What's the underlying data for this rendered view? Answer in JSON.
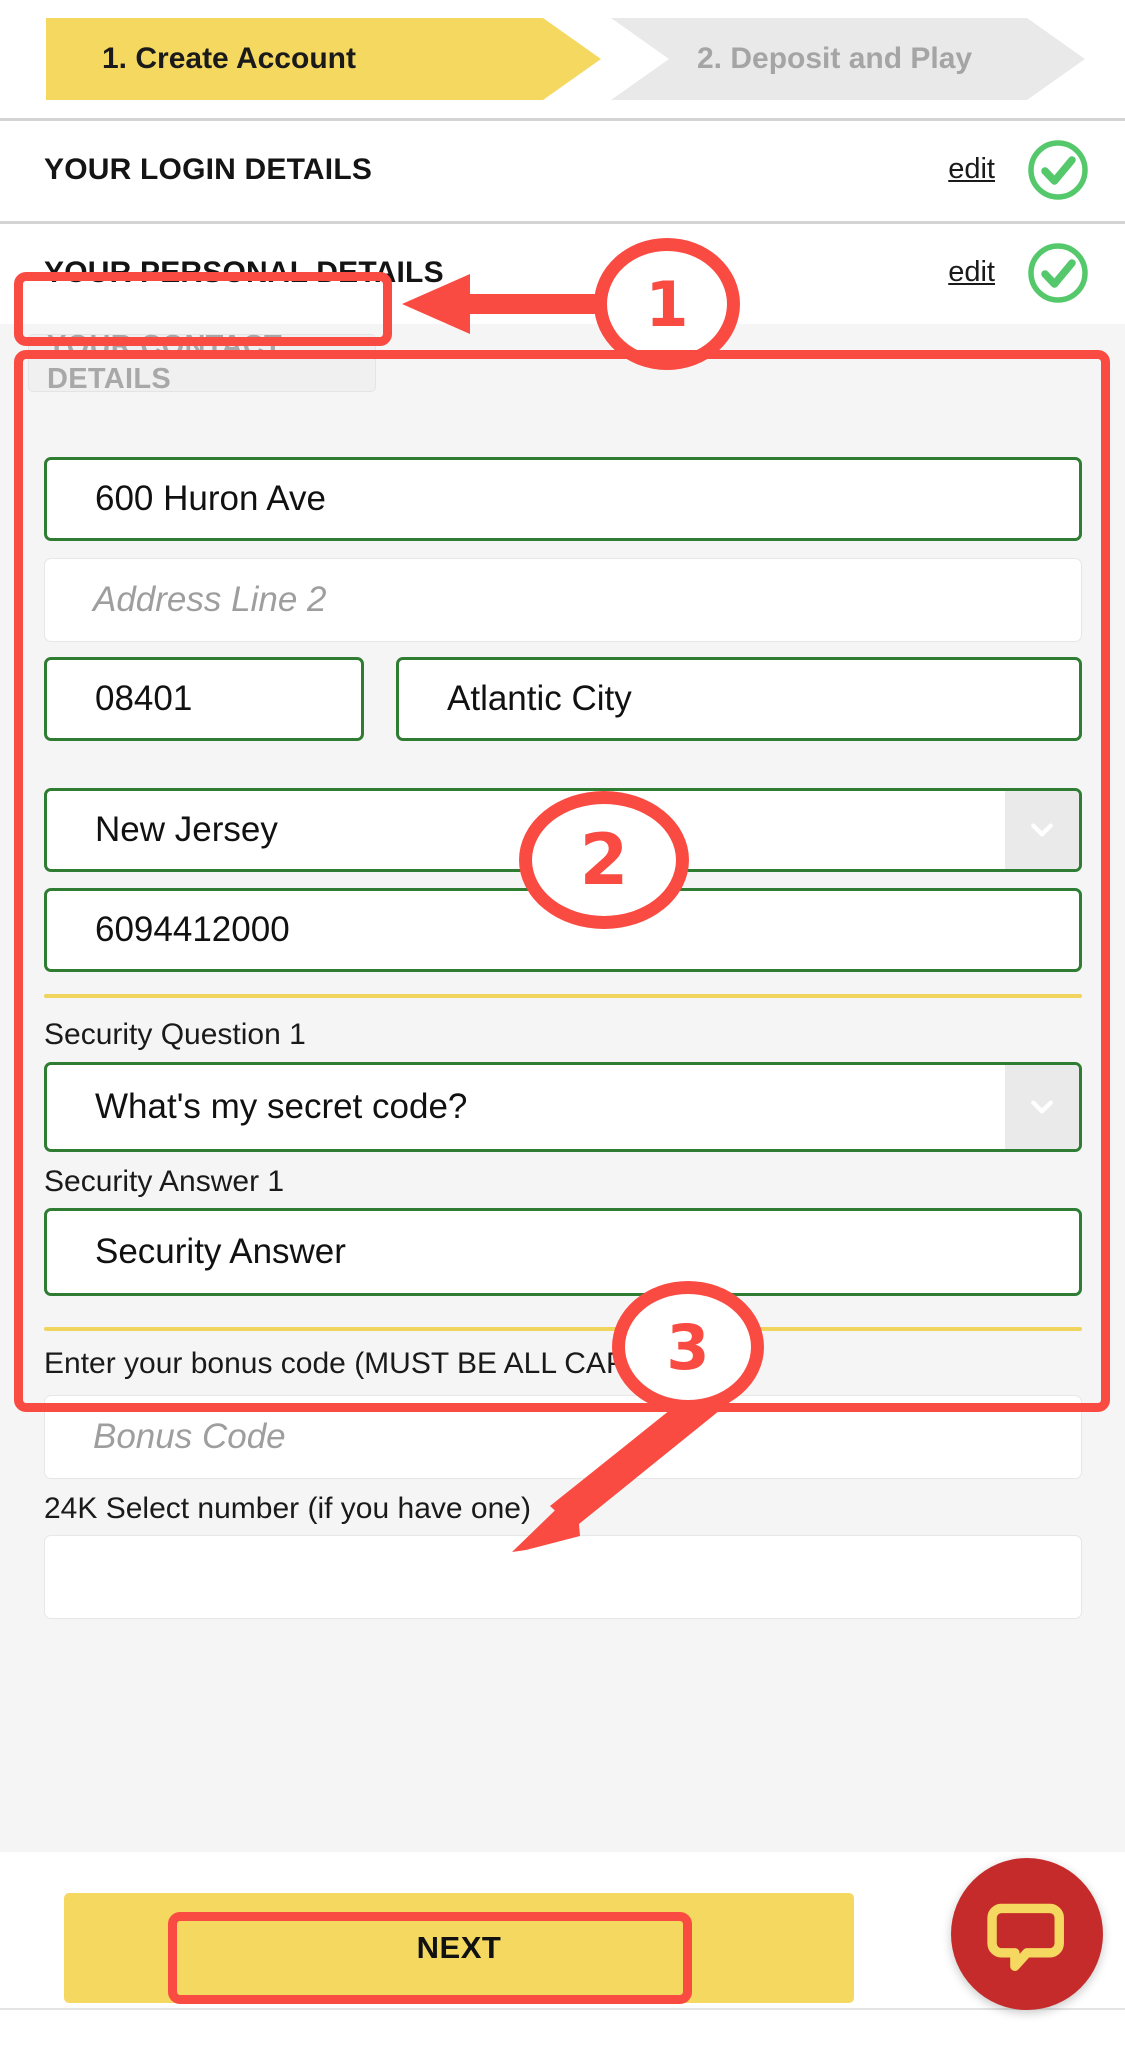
{
  "steps": [
    {
      "label": "1. Create Account",
      "state": "active"
    },
    {
      "label": "2. Deposit and Play",
      "state": "inactive"
    }
  ],
  "sections": [
    {
      "title": "YOUR LOGIN DETAILS",
      "edit_label": "edit",
      "status_icon": "check-circle-icon",
      "status": "complete"
    },
    {
      "title": "YOUR PERSONAL DETAILS",
      "edit_label": "edit",
      "status_icon": "check-circle-icon",
      "status": "complete"
    }
  ],
  "contact_section": {
    "title": "YOUR CONTACT DETAILS"
  },
  "form": {
    "address_line_1": {
      "value": "600 Huron Ave",
      "state": "valid"
    },
    "address_line_2": {
      "value": "",
      "placeholder": "Address Line 2",
      "state": "empty"
    },
    "zip": {
      "value": "08401",
      "state": "valid"
    },
    "city": {
      "value": "Atlantic City",
      "state": "valid"
    },
    "state_select": {
      "value": "New Jersey",
      "state": "valid",
      "caret_icon": "chevron-down-icon"
    },
    "phone": {
      "value": "6094412000",
      "state": "valid"
    },
    "security_question_1": {
      "label": "Security Question 1",
      "value": "What's my secret code?",
      "state": "valid",
      "caret_icon": "chevron-down-icon"
    },
    "security_answer_1": {
      "label": "Security Answer 1",
      "value": "Security Answer",
      "state": "valid"
    },
    "bonus_code": {
      "label": "Enter your bonus code (MUST BE ALL CAPS).",
      "value": "",
      "placeholder": "Bonus Code",
      "state": "empty"
    },
    "select_number": {
      "label": "24K Select number (if you have one)",
      "value": "",
      "placeholder": "",
      "state": "empty"
    }
  },
  "next_button": {
    "label": "NEXT"
  },
  "chat": {
    "icon": "chat-bubble-icon"
  },
  "annotations": [
    {
      "number": "1",
      "target": "contact-details-header"
    },
    {
      "number": "2",
      "target": "contact-details-form"
    },
    {
      "number": "3",
      "target": "next-button"
    }
  ],
  "colors": {
    "accent_yellow": "#f4d860",
    "valid_green": "#2e7d32",
    "annotation_red": "#fa4b42",
    "chat_red": "#c62b2b",
    "muted_grey": "#a8a8a8"
  }
}
